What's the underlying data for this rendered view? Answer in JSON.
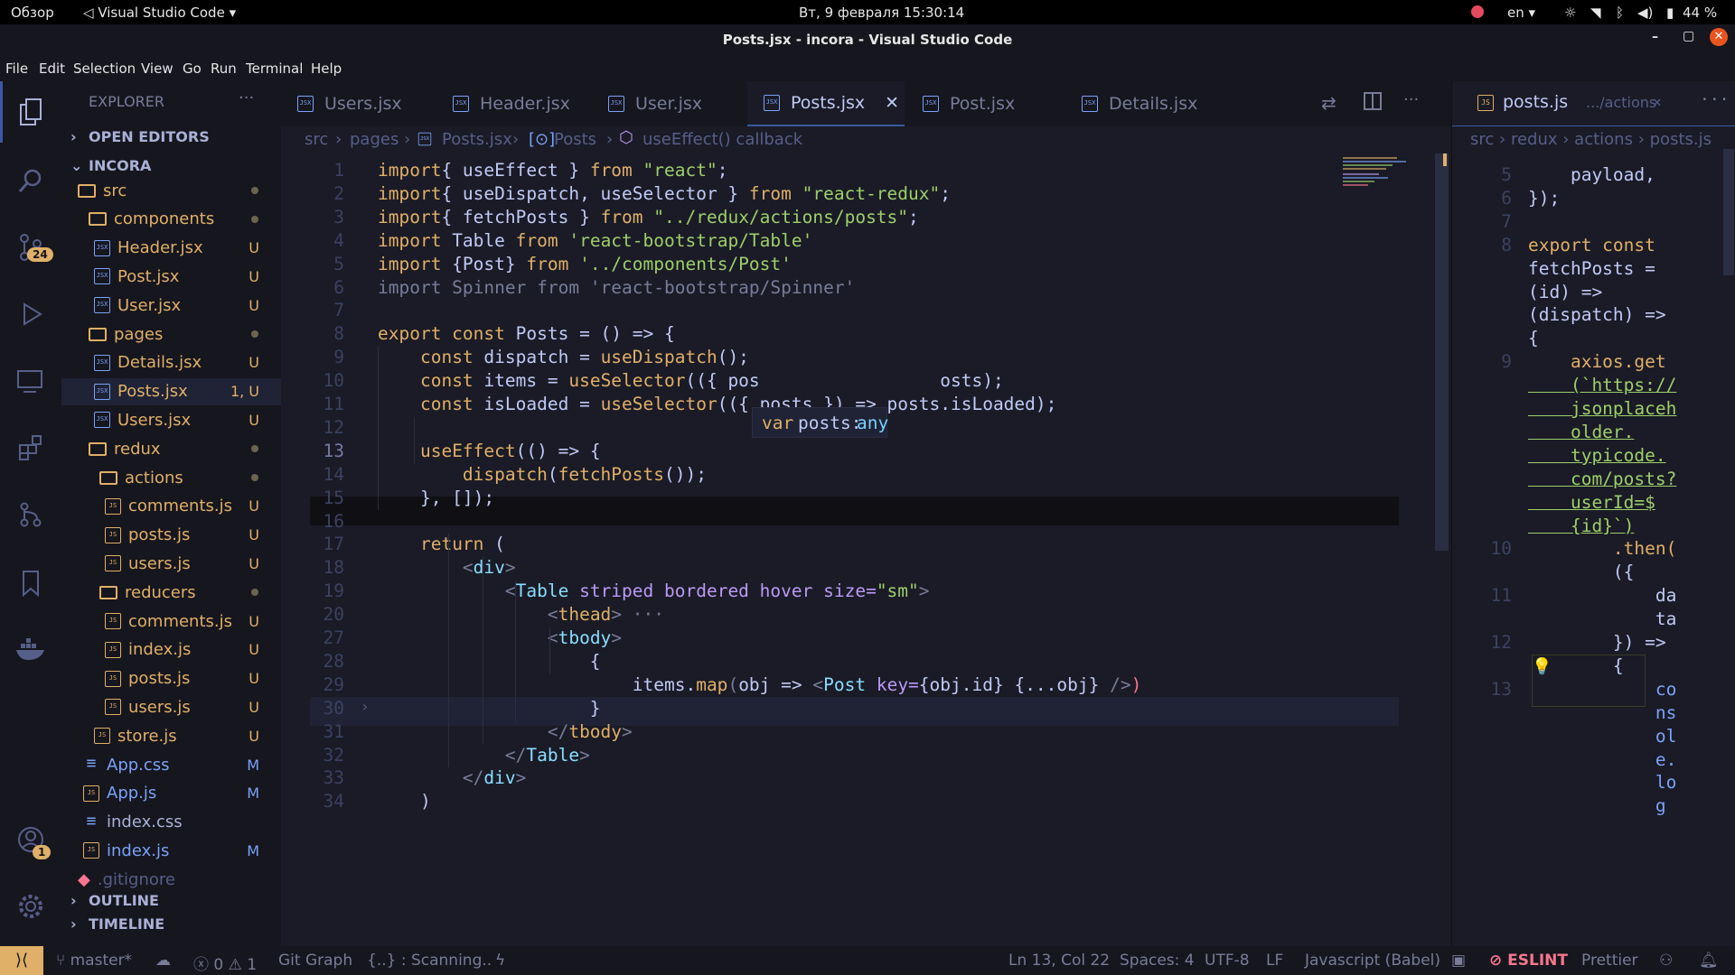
{
  "system": {
    "overview": "Обзор",
    "app_menu": "Visual Studio Code",
    "datetime": "Вт, 9 февраля  15:30:14",
    "lang": "en",
    "battery": "44 %"
  },
  "window": {
    "title": "Posts.jsx - incora - Visual Studio Code"
  },
  "menu": [
    "File",
    "Edit",
    "Selection",
    "View",
    "Go",
    "Run",
    "Terminal",
    "Help"
  ],
  "activity": {
    "scm_badge": "24",
    "account_badge": "1"
  },
  "explorer": {
    "title": "EXPLORER",
    "open_editors": "OPEN EDITORS",
    "project": "INCORA",
    "outline": "OUTLINE",
    "timeline": "TIMELINE",
    "tree": [
      {
        "name": "src",
        "kind": "folder",
        "status": "dot",
        "indent": 0
      },
      {
        "name": "components",
        "kind": "folder",
        "status": "dot",
        "indent": 1
      },
      {
        "name": "Header.jsx",
        "kind": "jsx",
        "status": "U",
        "indent": 1
      },
      {
        "name": "Post.jsx",
        "kind": "jsx",
        "status": "U",
        "indent": 1
      },
      {
        "name": "User.jsx",
        "kind": "jsx",
        "status": "U",
        "indent": 1
      },
      {
        "name": "pages",
        "kind": "folder",
        "status": "dot",
        "indent": 1
      },
      {
        "name": "Details.jsx",
        "kind": "jsx",
        "status": "U",
        "indent": 1
      },
      {
        "name": "Posts.jsx",
        "kind": "jsx",
        "status": "1, U",
        "indent": 1,
        "selected": true
      },
      {
        "name": "Users.jsx",
        "kind": "jsx",
        "status": "U",
        "indent": 1
      },
      {
        "name": "redux",
        "kind": "folder",
        "status": "dot",
        "indent": 1
      },
      {
        "name": "actions",
        "kind": "folder",
        "status": "dot",
        "indent": 2
      },
      {
        "name": "comments.js",
        "kind": "js",
        "status": "U",
        "indent": 2
      },
      {
        "name": "posts.js",
        "kind": "js",
        "status": "U",
        "indent": 2
      },
      {
        "name": "users.js",
        "kind": "js",
        "status": "U",
        "indent": 2
      },
      {
        "name": "reducers",
        "kind": "folder",
        "status": "dot",
        "indent": 2
      },
      {
        "name": "comments.js",
        "kind": "js",
        "status": "U",
        "indent": 2
      },
      {
        "name": "index.js",
        "kind": "js",
        "status": "U",
        "indent": 2
      },
      {
        "name": "posts.js",
        "kind": "js",
        "status": "U",
        "indent": 2
      },
      {
        "name": "users.js",
        "kind": "js",
        "status": "U",
        "indent": 2
      },
      {
        "name": "store.js",
        "kind": "js",
        "status": "U",
        "indent": 1
      },
      {
        "name": "App.css",
        "kind": "css",
        "status": "M",
        "indent": 0
      },
      {
        "name": "App.js",
        "kind": "js",
        "status": "M",
        "indent": 0
      },
      {
        "name": "index.css",
        "kind": "css",
        "status": "",
        "indent": 0
      },
      {
        "name": "index.js",
        "kind": "js",
        "status": "M",
        "indent": 0
      },
      {
        "name": ".gitignore",
        "kind": "git",
        "status": "",
        "indent": -1
      }
    ]
  },
  "tabs": [
    "Users.jsx",
    "Header.jsx",
    "User.jsx",
    "Posts.jsx",
    "Post.jsx",
    "Details.jsx"
  ],
  "active_tab": "Posts.jsx",
  "breadcrumb": [
    "src",
    "pages",
    "Posts.jsx",
    "Posts",
    "useEffect() callback"
  ],
  "hover": {
    "prefix": "var",
    "name": "posts:",
    "type": "any"
  },
  "gutter": [
    "1",
    "2",
    "3",
    "4",
    "5",
    "6",
    "7",
    "8",
    "9",
    "10",
    "11",
    "12",
    "13",
    "14",
    "15",
    "16",
    "17",
    "18",
    "19",
    "20",
    "27",
    "28",
    "29",
    "30",
    "31",
    "32",
    "33",
    "34"
  ],
  "code_lines": [
    [
      [
        "kw",
        "import"
      ],
      [
        "",
        "{ useEffect } "
      ],
      [
        "kw",
        "from"
      ],
      [
        "str",
        " \"react\""
      ],
      [
        "",
        ";"
      ]
    ],
    [
      [
        "kw",
        "import"
      ],
      [
        "",
        "{ useDispatch, useSelector } "
      ],
      [
        "kw",
        "from"
      ],
      [
        "str",
        " \"react-redux\""
      ],
      [
        "",
        ";"
      ]
    ],
    [
      [
        "kw",
        "import"
      ],
      [
        "",
        "{ fetchPosts } "
      ],
      [
        "kw",
        "from"
      ],
      [
        "str",
        " \"../redux/actions/posts\""
      ],
      [
        "",
        ";"
      ]
    ],
    [
      [
        "kw",
        "import"
      ],
      [
        "",
        " Table "
      ],
      [
        "kw",
        "from"
      ],
      [
        "str",
        " 'react-bootstrap/Table'"
      ]
    ],
    [
      [
        "kw",
        "import"
      ],
      [
        "",
        " {Post} "
      ],
      [
        "kw",
        "from"
      ],
      [
        "str",
        " '../components/Post'"
      ]
    ],
    [
      [
        "gy",
        "import Spinner from 'react-bootstrap/Spinner'"
      ]
    ],
    [],
    [
      [
        "kw",
        "export const"
      ],
      [
        "",
        " Posts = () => {"
      ]
    ],
    [
      [
        "",
        "    "
      ],
      [
        "kw",
        "const"
      ],
      [
        "",
        " dispatch = "
      ],
      [
        "kw",
        "useDispatch"
      ],
      [
        "",
        "();"
      ]
    ],
    [
      [
        "",
        "    "
      ],
      [
        "kw",
        "const"
      ],
      [
        "",
        " items = "
      ],
      [
        "kw",
        "useSelector"
      ],
      [
        "",
        "(({ pos"
      ],
      [
        "",
        ""
      ],
      [
        "",
        "                 osts);"
      ]
    ],
    [
      [
        "",
        "    "
      ],
      [
        "kw",
        "const"
      ],
      [
        "",
        " isLoaded = "
      ],
      [
        "kw",
        "useSelector"
      ],
      [
        "",
        "(({ posts }) => posts.isLoaded);"
      ]
    ],
    [],
    [
      [
        "",
        "    "
      ],
      [
        "kw",
        "useEffect"
      ],
      [
        "",
        "(() => {"
      ]
    ],
    [
      [
        "",
        "        "
      ],
      [
        "kw",
        "dispatch"
      ],
      [
        "",
        "("
      ],
      [
        "kw",
        "fetchPosts"
      ],
      [
        "",
        "());"
      ]
    ],
    [
      [
        "",
        "    }, []);"
      ]
    ],
    [],
    [
      [
        "",
        "    "
      ],
      [
        "kw",
        "return"
      ],
      [
        "",
        " ("
      ]
    ],
    [
      [
        "",
        "        "
      ],
      [
        "gy",
        "<"
      ],
      [
        "pn",
        "div"
      ],
      [
        "gy",
        ">"
      ]
    ],
    [
      [
        "",
        "            "
      ],
      [
        "gy",
        "<"
      ],
      [
        "pn",
        "Table"
      ],
      [
        "att",
        " striped bordered hover size="
      ],
      [
        "str",
        "\"sm\""
      ],
      [
        "gy",
        ">"
      ]
    ],
    [
      [
        "",
        "                "
      ],
      [
        "gy",
        "<"
      ],
      [
        "kw",
        "thead"
      ],
      [
        "gy",
        "> ···"
      ]
    ],
    [
      [
        "",
        "                "
      ],
      [
        "gy",
        "<"
      ],
      [
        "pn",
        "tbody"
      ],
      [
        "gy",
        ">"
      ]
    ],
    [
      [
        "",
        "                    {"
      ]
    ],
    [
      [
        "",
        "                        items."
      ],
      [
        "kw",
        "map"
      ],
      [
        "gy",
        "("
      ],
      [
        "",
        "obj => "
      ],
      [
        "gy",
        "<"
      ],
      [
        "pn",
        "Post"
      ],
      [
        "att",
        " key="
      ],
      [
        "",
        "{obj.id} {...obj} "
      ],
      [
        "gy",
        "/>"
      ],
      [
        "tg",
        ")"
      ]
    ],
    [
      [
        "",
        "                    }"
      ]
    ],
    [
      [
        "",
        "                "
      ],
      [
        "gy",
        "</"
      ],
      [
        "kw",
        "tbody"
      ],
      [
        "gy",
        ">"
      ]
    ],
    [
      [
        "",
        "            "
      ],
      [
        "gy",
        "</"
      ],
      [
        "pn",
        "Table"
      ],
      [
        "gy",
        ">"
      ]
    ],
    [
      [
        "",
        "        "
      ],
      [
        "gy",
        "</"
      ],
      [
        "pn",
        "div"
      ],
      [
        "gy",
        ">"
      ]
    ],
    [
      [
        "",
        "    )"
      ]
    ]
  ],
  "right_pane": {
    "tab": "posts.js",
    "tab_path": ".../actions",
    "breadcrumb": [
      "src",
      "redux",
      "actions",
      "posts.js"
    ],
    "lines": [
      {
        "n": "5",
        "t": "    payload,"
      },
      {
        "n": "6",
        "t": "});"
      },
      {
        "n": "7",
        "t": ""
      },
      {
        "n": "8",
        "t": "export const"
      },
      {
        "n": "",
        "t": "fetchPosts ="
      },
      {
        "n": "",
        "t": "(id) =>"
      },
      {
        "n": "",
        "t": "(dispatch) =>"
      },
      {
        "n": "",
        "t": "{"
      },
      {
        "n": "9",
        "t": "    axios.get"
      },
      {
        "n": "",
        "t": "    (`https://"
      },
      {
        "n": "",
        "t": "    jsonplaceh"
      },
      {
        "n": "",
        "t": "    older."
      },
      {
        "n": "",
        "t": "    typicode."
      },
      {
        "n": "",
        "t": "    com/posts?"
      },
      {
        "n": "",
        "t": "    userId=$"
      },
      {
        "n": "",
        "t": "    {id}`)"
      },
      {
        "n": "10",
        "t": "        .then("
      },
      {
        "n": "",
        "t": "        ({"
      },
      {
        "n": "11",
        "t": "            da"
      },
      {
        "n": "",
        "t": "            ta"
      },
      {
        "n": "12",
        "t": "        }) =>"
      },
      {
        "n": "",
        "t": "        {"
      },
      {
        "n": "13",
        "t": "            co"
      },
      {
        "n": "",
        "t": "            ns"
      },
      {
        "n": "",
        "t": "            ol"
      },
      {
        "n": "",
        "t": "            e."
      },
      {
        "n": "",
        "t": "            lo"
      },
      {
        "n": "",
        "t": "            g"
      }
    ]
  },
  "status": {
    "branch": "master*",
    "errors": "0",
    "warnings": "1",
    "git_graph": "Git Graph",
    "scanning": "{..} : Scanning..",
    "position": "Ln 13, Col 22",
    "spaces": "Spaces: 4",
    "encoding": "UTF-8",
    "eol": "LF",
    "language": "Javascript (Babel)",
    "eslint": "ESLINT",
    "prettier": "Prettier"
  }
}
